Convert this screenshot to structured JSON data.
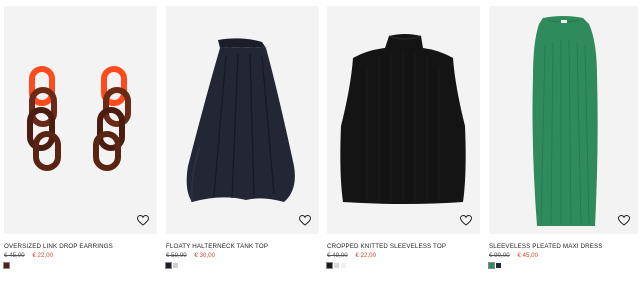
{
  "products": [
    {
      "title": "OVERSIZED LINK DROP EARRINGS",
      "old_price": "€ 45,00",
      "new_price": "€ 22,00",
      "swatches": [
        "#5a1a14"
      ]
    },
    {
      "title": "FLOATY HALTERNECK TANK TOP",
      "old_price": "€ 59,00",
      "new_price": "€ 30,00",
      "swatches": [
        "#1d1f2b",
        "#cfcfcf"
      ]
    },
    {
      "title": "CROPPED KNITTED SLEEVELESS TOP",
      "old_price": "€ 49,00",
      "new_price": "€ 22,00",
      "swatches": [
        "#1a1a1a",
        "#d9d9d9",
        "#f4f1ec"
      ]
    },
    {
      "title": "SLEEVELESS PLEATED MAXI DRESS",
      "old_price": "€ 90,00",
      "new_price": "€ 45,00",
      "swatches": [
        "#2f8a5c",
        "#1b2c35"
      ]
    }
  ],
  "icons": {
    "favorite": "heart-outline-icon"
  },
  "colors": {
    "sale_price": "#d4462f",
    "image_background": "#f3f3f3"
  }
}
